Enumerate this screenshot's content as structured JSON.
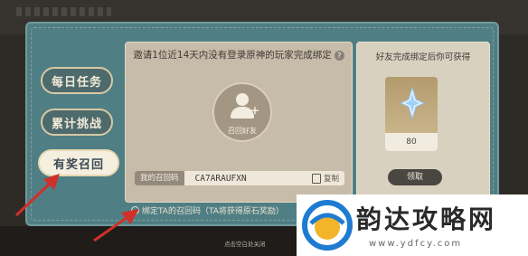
{
  "menu": {
    "items": [
      {
        "label": "每日任务"
      },
      {
        "label": "累计挑战"
      },
      {
        "label": "有奖召回"
      }
    ]
  },
  "main": {
    "title": "邀请1位近14天内没有登录原神的玩家完成绑定",
    "help_icon": "?",
    "recall_button_label": "召回好友",
    "code_label": "我的召回码",
    "code_value": "CA7ARAUFXN",
    "copy_label": "复制"
  },
  "side": {
    "title": "好友完成绑定后你可获得",
    "reward_icon": "primogem-star-icon",
    "reward_quantity": "80",
    "claim_label": "领取"
  },
  "bind_link": "绑定TA的召回码（TA将获得原石奖励）",
  "close_hint": "点击空白处关闭",
  "watermark": {
    "name": "韵达攻略网",
    "url": "www.ydfcy.com"
  },
  "colors": {
    "frame": "#4f7f84",
    "panel": "#c7bca9",
    "annotation_arrow": "#d0302a",
    "logo_blue": "#1f7bd1",
    "logo_yellow": "#f2b52a"
  }
}
